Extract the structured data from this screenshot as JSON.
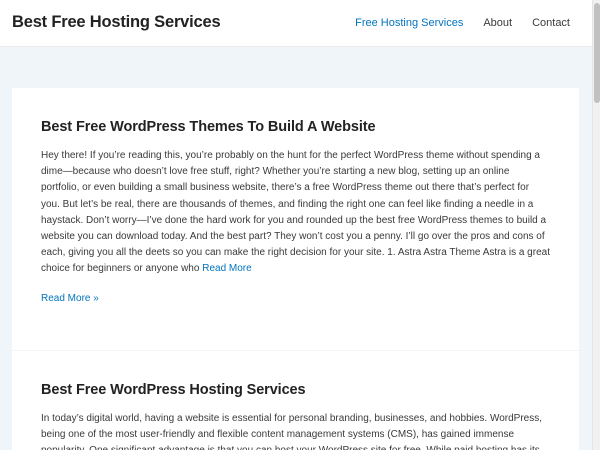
{
  "header": {
    "site_title": "Best Free Hosting Services",
    "nav": [
      {
        "label": "Free Hosting Services",
        "active": true
      },
      {
        "label": "About",
        "active": false
      },
      {
        "label": "Contact",
        "active": false
      }
    ]
  },
  "posts": [
    {
      "title": "Best Free WordPress Themes To Build A Website",
      "excerpt": "Hey there! If you’re reading this, you’re probably on the hunt for the perfect WordPress theme without spending a dime—because who doesn’t love free stuff, right? Whether you’re starting a new blog, setting up an online portfolio, or even building a small business website, there’s a free WordPress theme out there that’s perfect for you. But let’s be real, there are thousands of themes, and finding the right one can feel like finding a needle in a haystack. Don’t worry—I’ve done the hard work for you and rounded up the best free WordPress themes to build a website you can download today. And the best part? They won’t cost you a penny. I’ll go over the pros and cons of each, giving you all the deets so you can make the right decision for your site. 1. Astra Astra Theme Astra is a great choice for beginners or anyone who",
      "inline_link": "Read More",
      "read_more": "Read More »"
    },
    {
      "title": "Best Free WordPress Hosting Services",
      "excerpt": "In today’s digital world, having a website is essential for personal branding, businesses, and hobbies. WordPress, being one of the most user-friendly and flexible content management systems (CMS), has gained immense popularity. One significant advantage is that you can host your WordPress site for free. While paid hosting has its"
    }
  ],
  "colors": {
    "accent": "#0274be",
    "background": "#f0f5fa",
    "card": "#ffffff",
    "text": "#3a3a3a",
    "heading": "#222222"
  }
}
